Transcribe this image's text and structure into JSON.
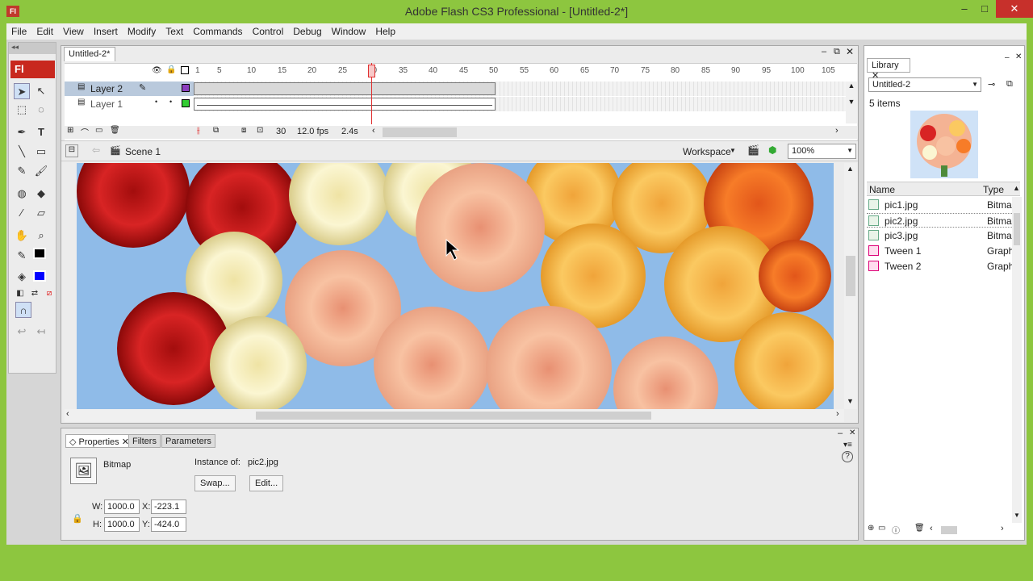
{
  "window": {
    "title": "Adobe Flash CS3 Professional - [Untitled-2*]",
    "icon": "Fl"
  },
  "menu": [
    "File",
    "Edit",
    "View",
    "Insert",
    "Modify",
    "Text",
    "Commands",
    "Control",
    "Debug",
    "Window",
    "Help"
  ],
  "tools": {
    "logo": "Fl"
  },
  "document": {
    "tab": "Untitled-2*"
  },
  "timeline": {
    "layers": [
      {
        "name": "Layer 2",
        "color": "#8b3fbf"
      },
      {
        "name": "Layer 1",
        "color": "#33cc33"
      }
    ],
    "ruler": [
      "1",
      "5",
      "10",
      "15",
      "20",
      "25",
      "30",
      "35",
      "40",
      "45",
      "50",
      "55",
      "60",
      "65",
      "70",
      "75",
      "80",
      "85",
      "90",
      "95",
      "100",
      "105"
    ],
    "current_frame": "30",
    "fps": "12.0 fps",
    "time": "2.4s"
  },
  "editbar": {
    "scene": "Scene 1",
    "workspace": "Workspace",
    "zoom": "100%"
  },
  "properties": {
    "tabs": [
      "Properties",
      "Filters",
      "Parameters"
    ],
    "type": "Bitmap",
    "instance_of_label": "Instance of:",
    "instance_of": "pic2.jpg",
    "swap_label": "Swap...",
    "edit_label": "Edit...",
    "w_label": "W:",
    "h_label": "H:",
    "x_label": "X:",
    "y_label": "Y:",
    "w": "1000.0",
    "h": "1000.0",
    "x": "-223.1",
    "y": "-424.0"
  },
  "library": {
    "tab": "Library",
    "doc": "Untitled-2",
    "count": "5 items",
    "col_name": "Name",
    "col_type": "Type",
    "items": [
      {
        "name": "pic1.jpg",
        "type": "Bitmap"
      },
      {
        "name": "pic2.jpg",
        "type": "Bitmap"
      },
      {
        "name": "pic3.jpg",
        "type": "Bitmap"
      },
      {
        "name": "Tween 1",
        "type": "Graphic"
      },
      {
        "name": "Tween 2",
        "type": "Graphic"
      }
    ]
  }
}
